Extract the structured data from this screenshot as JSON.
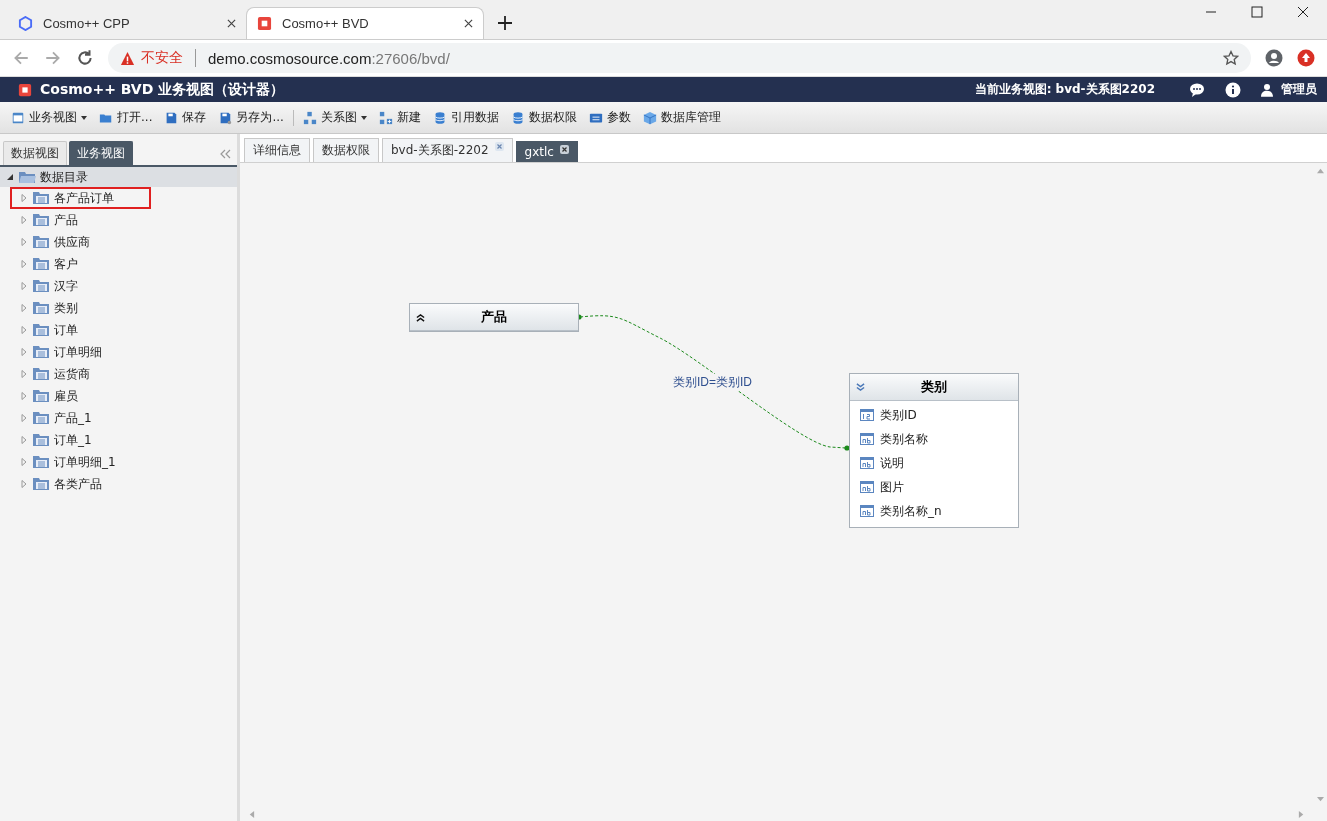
{
  "browser": {
    "tabs": [
      {
        "title": "Cosmo++ CPP",
        "selected": false
      },
      {
        "title": "Cosmo++ BVD",
        "selected": true
      }
    ],
    "security": "不安全",
    "url_host": "demo.cosmosource.com",
    "url_path": ":27606/bvd/"
  },
  "app": {
    "title": "Cosmo++ BVD 业务视图（设计器）",
    "current_view": "当前业务视图: bvd-关系图2202",
    "user": "管理员"
  },
  "toolbar": [
    {
      "label": "业务视图",
      "kind": "view",
      "dropdown": true
    },
    {
      "label": "打开...",
      "kind": "open",
      "dropdown": false
    },
    {
      "label": "保存",
      "kind": "save",
      "dropdown": false
    },
    {
      "label": "另存为...",
      "kind": "saveas",
      "dropdown": false
    },
    {
      "label": "关系图",
      "kind": "diagram",
      "dropdown": true
    },
    {
      "label": "新建",
      "kind": "new",
      "dropdown": false
    },
    {
      "label": "引用数据",
      "kind": "db",
      "dropdown": false
    },
    {
      "label": "数据权限",
      "kind": "db",
      "dropdown": false
    },
    {
      "label": "参数",
      "kind": "params",
      "dropdown": false
    },
    {
      "label": "数据库管理",
      "kind": "cube",
      "dropdown": false
    }
  ],
  "left_tabs": [
    {
      "label": "数据视图",
      "selected": false
    },
    {
      "label": "业务视图",
      "selected": true
    }
  ],
  "tree": {
    "label": "数据目录",
    "expanded": true,
    "children": [
      {
        "label": "各产品订单",
        "expanded": false,
        "highlighted": true
      },
      {
        "label": "产品",
        "expanded": false,
        "highlighted": false
      },
      {
        "label": "供应商",
        "expanded": false,
        "highlighted": false
      },
      {
        "label": "客户",
        "expanded": false,
        "highlighted": false
      },
      {
        "label": "汉字",
        "expanded": false,
        "highlighted": false
      },
      {
        "label": "类别",
        "expanded": false,
        "highlighted": false
      },
      {
        "label": "订单",
        "expanded": false,
        "highlighted": false
      },
      {
        "label": "订单明细",
        "expanded": false,
        "highlighted": false
      },
      {
        "label": "运货商",
        "expanded": false,
        "highlighted": false
      },
      {
        "label": "雇员",
        "expanded": false,
        "highlighted": false
      },
      {
        "label": "产品_1",
        "expanded": false,
        "highlighted": false
      },
      {
        "label": "订单_1",
        "expanded": false,
        "highlighted": false
      },
      {
        "label": "订单明细_1",
        "expanded": false,
        "highlighted": false
      },
      {
        "label": "各类产品",
        "expanded": false,
        "highlighted": false
      }
    ]
  },
  "main_tabs": [
    {
      "label": "详细信息",
      "selected": false,
      "closable": false
    },
    {
      "label": "数据权限",
      "selected": false,
      "closable": false
    },
    {
      "label": "bvd-关系图-2202",
      "selected": false,
      "closable": true
    },
    {
      "label": "gxtlc",
      "selected": true,
      "closable": true
    }
  ],
  "diagram": {
    "tables": [
      {
        "name": "产品",
        "expanded": false
      },
      {
        "name": "类别",
        "expanded": true,
        "fields": [
          {
            "name": "类别ID",
            "kind": "number"
          },
          {
            "name": "类别名称",
            "kind": "text"
          },
          {
            "name": "说明",
            "kind": "text"
          },
          {
            "name": "图片",
            "kind": "text"
          },
          {
            "name": "类别名称_n",
            "kind": "text"
          }
        ]
      }
    ],
    "relation": {
      "label": "类别ID=类别ID"
    }
  }
}
